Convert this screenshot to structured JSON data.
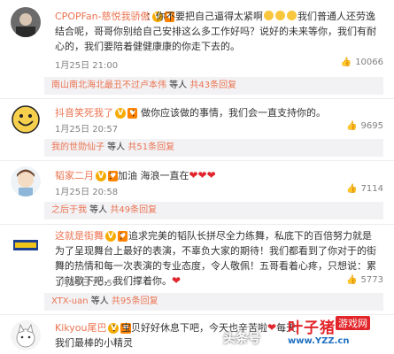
{
  "comments": [
    {
      "username": "CPOPFan-慈悦我骄傲",
      "badge": "V",
      "text": "：你不要把自己逼得太紧啊",
      "text_tail": "我们普通人还劳逸结合呢，哥哥你别给自己安排这么多工作好吗？说好的未来等你，我们有耐心的，我们要陪着健健康康的你走下去的。",
      "time": "1月25日 21:00",
      "likes": "10066",
      "reply_user": "南山南北海北最丑不过卢本伟",
      "reply_mid": " 等人 ",
      "reply_count": "共43条回复"
    },
    {
      "username": "抖音笑死我了",
      "badge": "V",
      "text": "：做你应该做的事情，我们会一直支持你的。",
      "time": "1月25日 20:57",
      "likes": "9695",
      "reply_user": "我的世勋仙子",
      "reply_mid": " 等人 ",
      "reply_count": "共51条回复"
    },
    {
      "username": "韬家二月",
      "badge": "V",
      "text": "：加油 海浪一直在",
      "time": "1月25日 20:58",
      "likes": "7114",
      "reply_user": "之后于我",
      "reply_mid": " 等人 ",
      "reply_count": "共49条回复"
    },
    {
      "username": "这就是街舞",
      "badge": "V",
      "text": "：追求完美的韬队长拼尽全力练舞，私底下的百倍努力就是为了呈现舞台上最好的表演，不辜负大家的期待！我们都看到了你对于的街舞的热情和每一次表演的专业态度，令人敬佩！五哥看着心疼，只想说：累了就歇下吧，我们撑着你。",
      "time": "1月25日 20:59",
      "likes": "5773",
      "reply_user": "XTX-uan",
      "reply_mid": " 等人 ",
      "reply_count": "共95条回复"
    },
    {
      "username": "Kikyou尾巴",
      "badge": "V",
      "text": "：宝贝好好休息下吧，今天也辛苦啦",
      "text_tail": "每天连轴转",
      "reply_user": "我们最棒的小精灵"
    }
  ],
  "watermark": {
    "toutiao": "头条号",
    "site_name": "叶子猪",
    "site_tag": "游戏网",
    "site_url": "www.YZZ.cn"
  },
  "colors": {
    "username": "#eb7350",
    "meta": "#808080",
    "reply_bg": "#f2f2f5",
    "heart": "#e0262c"
  }
}
